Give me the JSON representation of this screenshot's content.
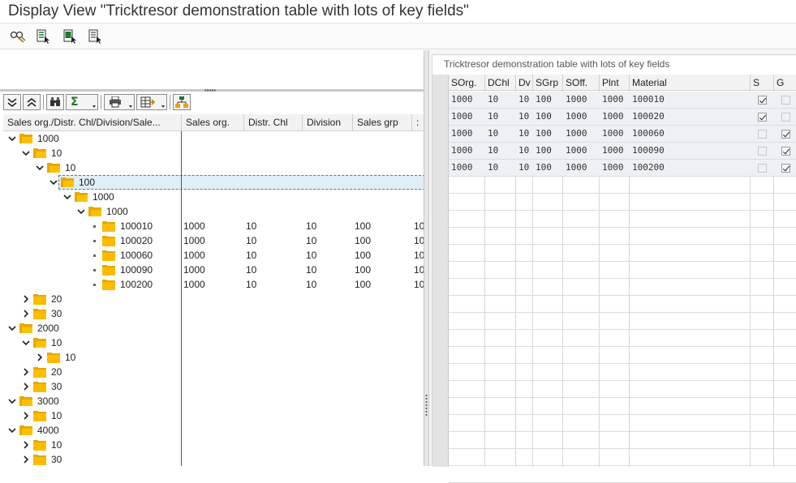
{
  "window": {
    "title": "Display View \"Tricktresor demonstration table with lots of key fields\""
  },
  "app_toolbar": {
    "icons": [
      "display-change-icon",
      "select-all-icon",
      "select-block-icon",
      "deselect-all-icon"
    ]
  },
  "tree_toolbar": {
    "icons": [
      "expand-all-icon",
      "collapse-all-icon",
      "find-icon",
      "sum-icon",
      "print-icon",
      "export-icon",
      "hierarchy-icon"
    ]
  },
  "tree": {
    "columns": [
      "Sales org./Distr. Chl/Division/Sale...",
      "Sales org.",
      "Distr. Chl",
      "Division",
      "Sales grp",
      ":"
    ],
    "rows": [
      {
        "level": 0,
        "label": "1000",
        "expanded": true,
        "type": "folder",
        "cells": []
      },
      {
        "level": 1,
        "label": "10",
        "expanded": true,
        "type": "folder",
        "cells": []
      },
      {
        "level": 2,
        "label": "10",
        "expanded": true,
        "type": "folder",
        "cells": []
      },
      {
        "level": 3,
        "label": "100",
        "expanded": true,
        "type": "folder",
        "cells": [],
        "selected": true
      },
      {
        "level": 4,
        "label": "1000",
        "expanded": true,
        "type": "folder",
        "cells": []
      },
      {
        "level": 5,
        "label": "1000",
        "expanded": true,
        "type": "folder",
        "cells": []
      },
      {
        "level": 6,
        "label": "100010",
        "type": "leaf",
        "cells": [
          "1000",
          "10",
          "10",
          "100",
          "10"
        ]
      },
      {
        "level": 6,
        "label": "100020",
        "type": "leaf",
        "cells": [
          "1000",
          "10",
          "10",
          "100",
          "10"
        ]
      },
      {
        "level": 6,
        "label": "100060",
        "type": "leaf",
        "cells": [
          "1000",
          "10",
          "10",
          "100",
          "10"
        ]
      },
      {
        "level": 6,
        "label": "100090",
        "type": "leaf",
        "cells": [
          "1000",
          "10",
          "10",
          "100",
          "10"
        ]
      },
      {
        "level": 6,
        "label": "100200",
        "type": "leaf",
        "cells": [
          "1000",
          "10",
          "10",
          "100",
          "10"
        ]
      },
      {
        "level": 1,
        "label": "20",
        "expanded": false,
        "type": "folder",
        "cells": []
      },
      {
        "level": 1,
        "label": "30",
        "expanded": false,
        "type": "folder",
        "cells": []
      },
      {
        "level": 0,
        "label": "2000",
        "expanded": true,
        "type": "folder",
        "cells": []
      },
      {
        "level": 1,
        "label": "10",
        "expanded": true,
        "type": "folder",
        "cells": []
      },
      {
        "level": 2,
        "label": "10",
        "expanded": false,
        "type": "folder",
        "cells": []
      },
      {
        "level": 1,
        "label": "20",
        "expanded": false,
        "type": "folder",
        "cells": []
      },
      {
        "level": 1,
        "label": "30",
        "expanded": false,
        "type": "folder",
        "cells": []
      },
      {
        "level": 0,
        "label": "3000",
        "expanded": true,
        "type": "folder",
        "cells": []
      },
      {
        "level": 1,
        "label": "10",
        "expanded": false,
        "type": "folder",
        "cells": []
      },
      {
        "level": 0,
        "label": "4000",
        "expanded": true,
        "type": "folder",
        "cells": []
      },
      {
        "level": 1,
        "label": "10",
        "expanded": false,
        "type": "folder",
        "cells": []
      },
      {
        "level": 1,
        "label": "30",
        "expanded": false,
        "type": "folder",
        "cells": []
      }
    ]
  },
  "table": {
    "title": "Tricktresor demonstration table with lots of key fields",
    "columns": [
      "SOrg.",
      "DChl",
      "Dv",
      "SGrp",
      "SOff.",
      "Plnt",
      "Material",
      "S",
      "G"
    ],
    "rows": [
      {
        "cells": [
          "1000",
          "10",
          "10",
          "100",
          "1000",
          "1000",
          "100010"
        ],
        "s": true,
        "g": false
      },
      {
        "cells": [
          "1000",
          "10",
          "10",
          "100",
          "1000",
          "1000",
          "100020"
        ],
        "s": true,
        "g": false
      },
      {
        "cells": [
          "1000",
          "10",
          "10",
          "100",
          "1000",
          "1000",
          "100060"
        ],
        "s": false,
        "g": true
      },
      {
        "cells": [
          "1000",
          "10",
          "10",
          "100",
          "1000",
          "1000",
          "100090"
        ],
        "s": false,
        "g": true
      },
      {
        "cells": [
          "1000",
          "10",
          "10",
          "100",
          "1000",
          "1000",
          "100200"
        ],
        "s": false,
        "g": true
      }
    ]
  }
}
